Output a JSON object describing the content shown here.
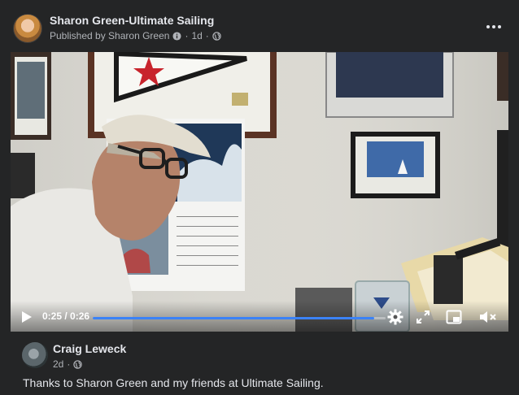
{
  "post": {
    "author": "Sharon Green-Ultimate Sailing",
    "published_by": "Published by Sharon Green",
    "separator": "·",
    "time": "1d",
    "privacy_icon": "globe-icon",
    "more_icon": "more-options-icon"
  },
  "video": {
    "current_time": "0:25",
    "duration": "0:26",
    "time_label": "0:25 / 0:26",
    "progress_fraction": 0.96,
    "accent": "#3b82f6",
    "controls": [
      "play-icon",
      "settings-gear-icon",
      "fullscreen-expand-icon",
      "picture-in-picture-icon",
      "mute-icon"
    ]
  },
  "comment": {
    "author": "Craig Leweck",
    "time": "2d",
    "separator": "·",
    "text": "Thanks to Sharon Green and my friends at Ultimate Sailing."
  }
}
